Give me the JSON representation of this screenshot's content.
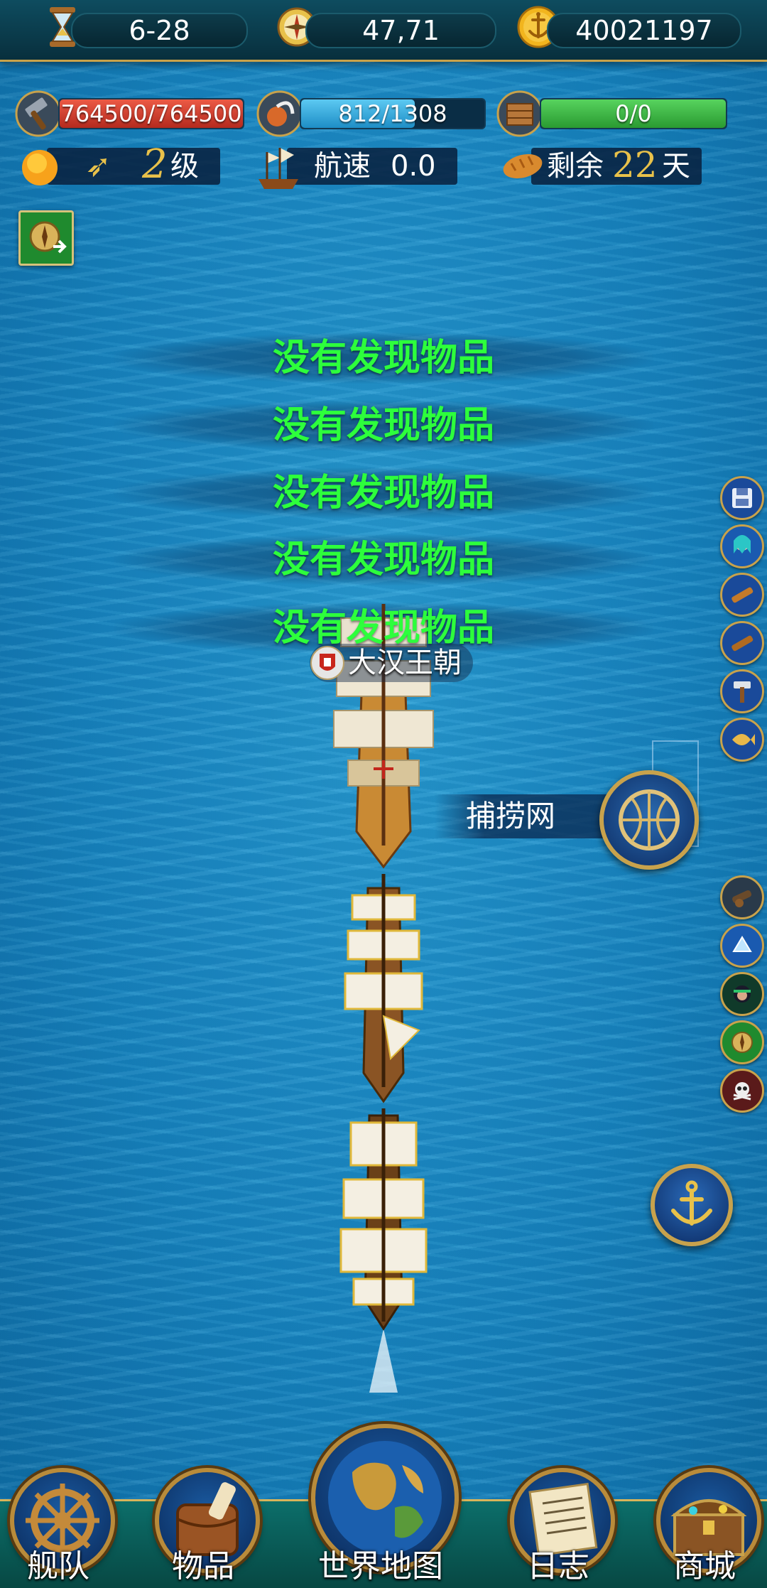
{
  "topbar": {
    "date": "6-28",
    "coords": "47,71",
    "gold": "40021197",
    "icons": [
      "hourglass-icon",
      "compass-icon",
      "gold-anchor-coin-icon"
    ]
  },
  "stats": {
    "durability": "764500/764500",
    "durability_fraction": 1.0,
    "sailors": "812/1308",
    "sailors_fraction": 0.62,
    "cargo": "0/0",
    "cargo_fraction": 1.0
  },
  "info": {
    "level_number": "2",
    "level_unit": "级",
    "speed_label": "航速",
    "speed_value": "0.0",
    "remaining_label": "剩余",
    "remaining_days": "22",
    "remaining_unit": "天"
  },
  "messages": [
    "没有发现物品",
    "没有发现物品",
    "没有发现物品",
    "没有发现物品",
    "没有发现物品"
  ],
  "fleet": {
    "name": "大汉王朝",
    "flag_icon": "portugal-flag-icon"
  },
  "action": {
    "label": "捕捞网",
    "icon": "fishing-net-icon"
  },
  "side_buttons_top": [
    "save-icon",
    "mermaid-icon",
    "telescope-icon",
    "telescope-icon",
    "hammer-icon",
    "fish-icon"
  ],
  "side_buttons_bottom": [
    "cannon-icon",
    "ice-icon",
    "pirate-woman-icon",
    "compass-icon",
    "skull-icon"
  ],
  "nav": {
    "fleet": "舰队",
    "items": "物品",
    "world_map": "世界地图",
    "log": "日志",
    "shop": "商城"
  },
  "colors": {
    "sea": "#1787c2",
    "durability": "#d33a2c",
    "sailors": "#2ea7df",
    "cargo": "#33b23a",
    "message": "#2dff3c",
    "gold_accent": "#e8c14a"
  }
}
